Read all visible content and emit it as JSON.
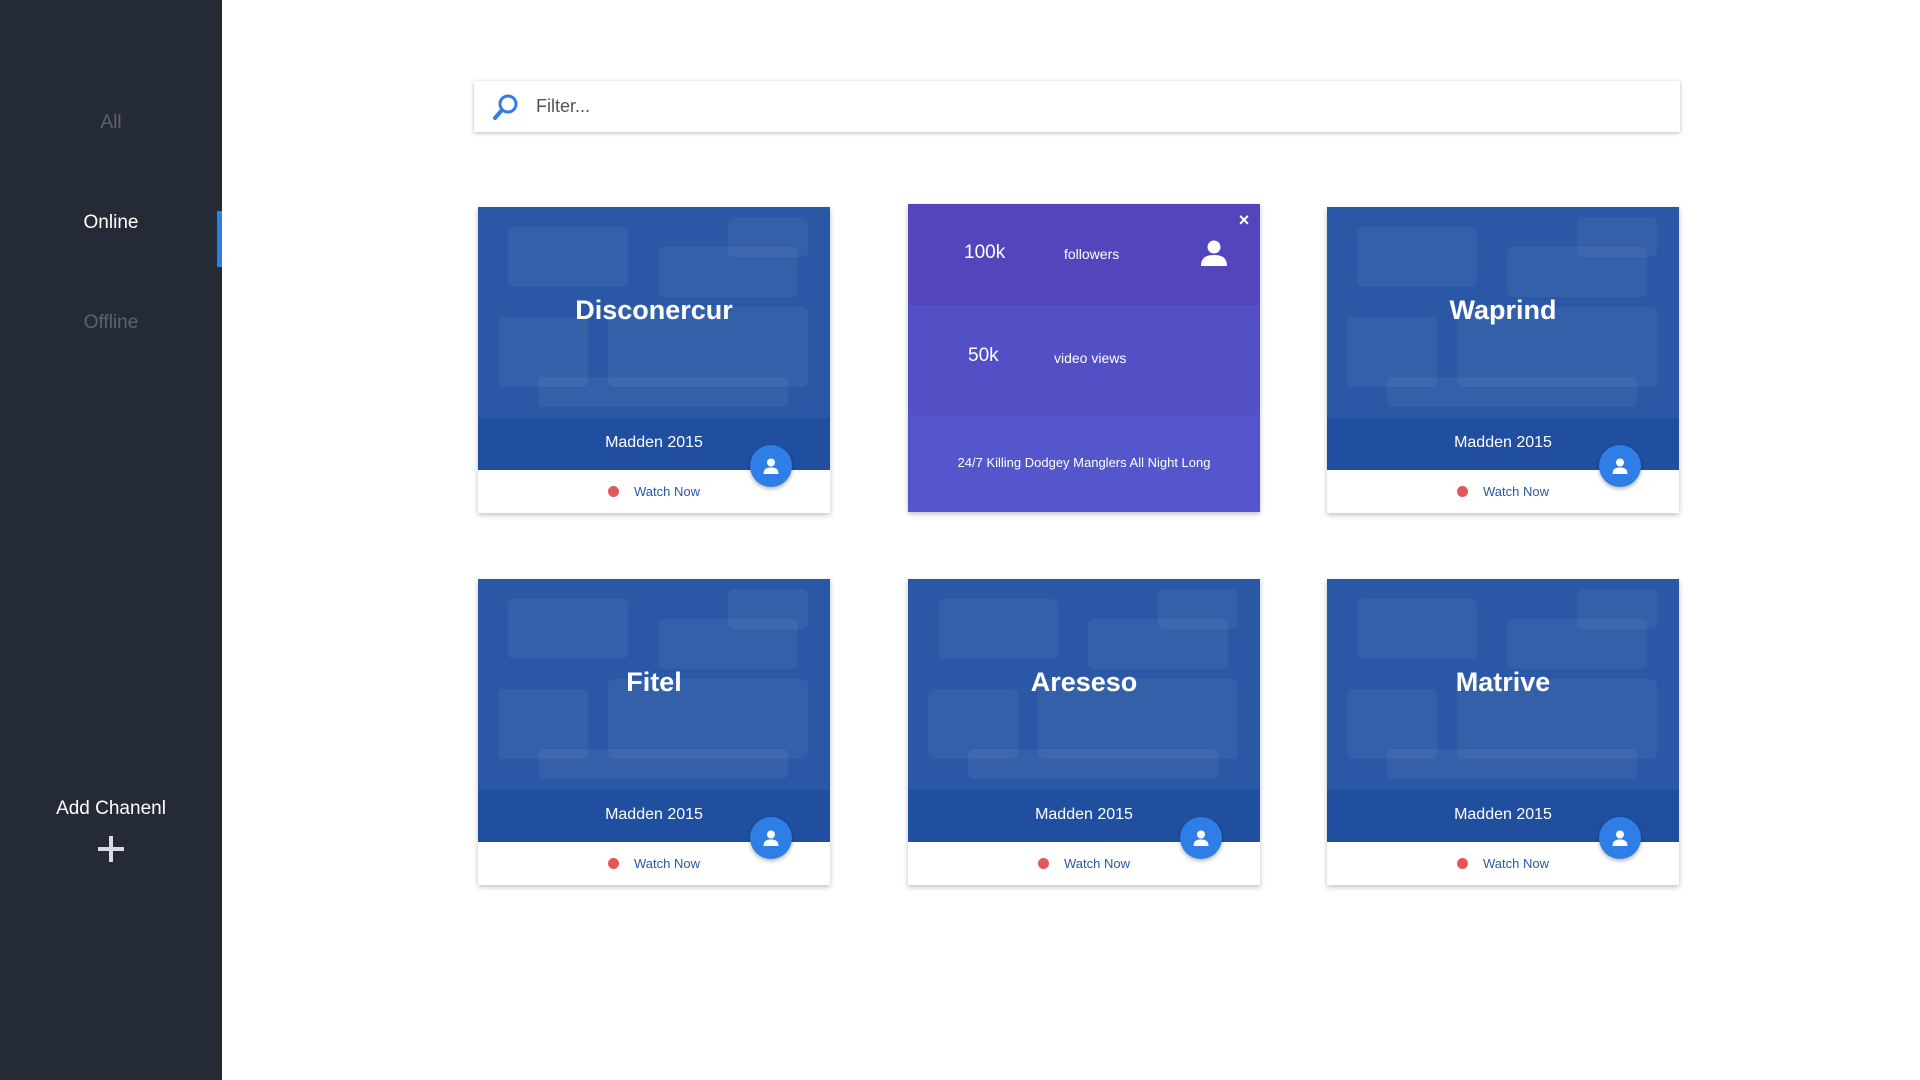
{
  "sidebar": {
    "nav": [
      {
        "label": "All"
      },
      {
        "label": "Online"
      },
      {
        "label": "Offline"
      }
    ],
    "active_item": "Online",
    "add_channel_label": "Add Chanenl"
  },
  "search": {
    "placeholder": "Filter..."
  },
  "cards": [
    {
      "title": "Disconercur",
      "game": "Madden 2015",
      "action": "Watch Now"
    },
    {
      "title": "Waprind",
      "game": "Madden 2015",
      "action": "Watch Now"
    },
    {
      "title": "Fitel",
      "game": "Madden 2015",
      "action": "Watch Now"
    },
    {
      "title": "Areseso",
      "game": "Madden 2015",
      "action": "Watch Now"
    },
    {
      "title": "Matrive",
      "game": "Madden 2015",
      "action": "Watch Now"
    }
  ],
  "stats_card": {
    "followers_value": "100k",
    "followers_label": "followers",
    "views_value": "50k",
    "views_label": "video views",
    "description": "24/7 Killing Dodgey Manglers All Night Long",
    "close_symbol": "×"
  },
  "colors": {
    "sidebar_bg": "#252a37",
    "accent": "#2f7de6",
    "card_hero": "#2a58a6",
    "card_band": "#1f4f9e",
    "live_dot": "#e5565a",
    "stats_purple": "#5545bd"
  },
  "icons": {
    "search": "search-icon",
    "add": "plus-icon",
    "avatar": "user-icon",
    "close": "close-icon"
  }
}
